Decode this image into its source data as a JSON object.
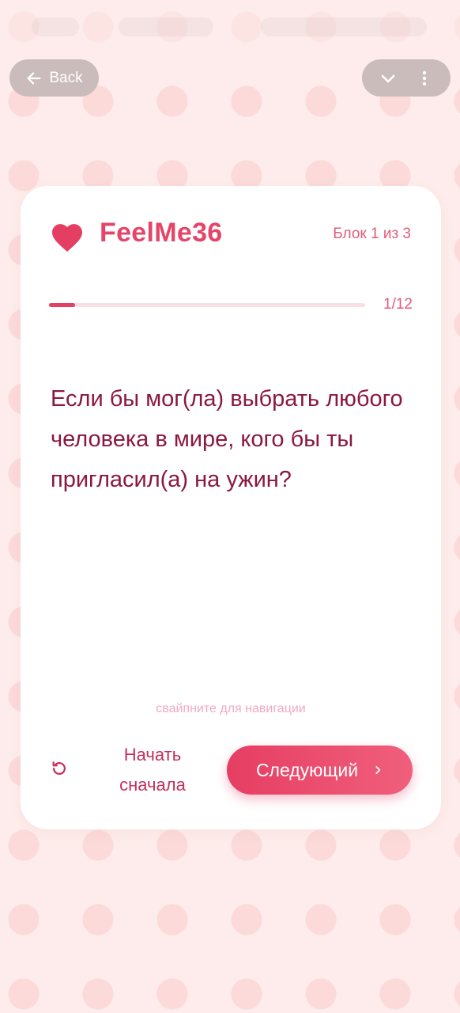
{
  "topbar": {
    "back_label": "Back"
  },
  "card": {
    "app_name": "FeelMe36",
    "block_label": "Блок 1 из 3",
    "progress": {
      "current": 1,
      "total": 12,
      "label": "1/12",
      "fraction": 0.083
    },
    "question": "Если бы мог(ла) выбрать любого человека в мире, кого бы ты пригласил(а) на ужин?",
    "swipe_hint": "свайпните для навигации",
    "restart_label": "Начать сначала",
    "next_label": "Следующий"
  },
  "colors": {
    "accent": "#e44569",
    "question_text": "#8a1840",
    "background": "#fdeceb"
  },
  "icons": {
    "back": "arrow-left-icon",
    "collapse": "chevron-down-icon",
    "more": "more-vertical-icon",
    "logo": "heart-icon",
    "restart": "restart-icon",
    "next": "chevron-right-icon"
  }
}
